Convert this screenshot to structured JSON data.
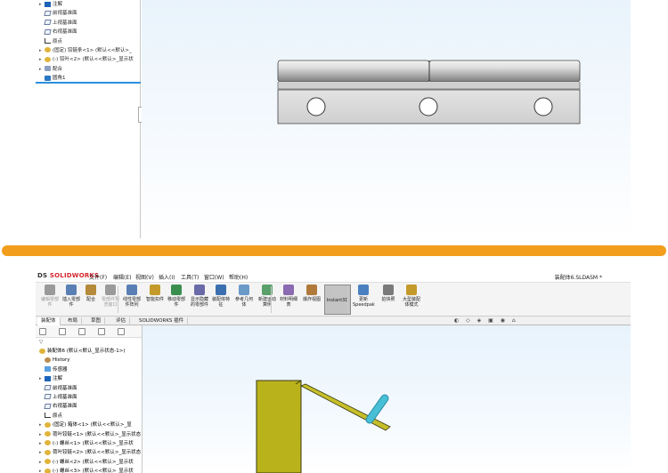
{
  "top_tree": {
    "items": [
      {
        "label": "注解",
        "icon": "annotation-icon",
        "expand": "▸"
      },
      {
        "label": "前视基准面",
        "icon": "plane-icon",
        "expand": ""
      },
      {
        "label": "上视基准面",
        "icon": "plane-icon",
        "expand": ""
      },
      {
        "label": "右视基准面",
        "icon": "plane-icon",
        "expand": ""
      },
      {
        "label": "原点",
        "icon": "origin-icon",
        "expand": ""
      },
      {
        "label": "(固定) 铰链条<1> (默认<<默认>_",
        "icon": "part-icon",
        "expand": "▸"
      },
      {
        "label": "(-) 铰叶<2> (默认<<默认>_显示状",
        "icon": "part-icon",
        "expand": "▸"
      },
      {
        "label": "配合",
        "icon": "mate-icon",
        "expand": "▸"
      },
      {
        "label": "圆角1",
        "icon": "fillet-icon",
        "expand": ""
      }
    ]
  },
  "app": {
    "logo_prefix": "DS",
    "logo_text": "SOLIDWORKS",
    "menus": [
      "文件(F)",
      "编辑(E)",
      "视图(V)",
      "插入(I)",
      "工具(T)",
      "窗口(W)",
      "帮助(H)"
    ],
    "document_title": "装配体6.SLDASM *"
  },
  "ribbon": {
    "buttons": [
      {
        "label": "编辑零部件",
        "disabled": true
      },
      {
        "label": "插入零部件",
        "disabled": false
      },
      {
        "label": "配合",
        "disabled": false
      },
      {
        "label": "零部件预览窗口",
        "disabled": true
      },
      {
        "label": "线性零部件阵列",
        "disabled": false
      },
      {
        "label": "智能扣件",
        "disabled": false
      },
      {
        "label": "移动零部件",
        "disabled": false
      },
      {
        "label": "显示隐藏的零部件",
        "disabled": false
      },
      {
        "label": "装配体特征",
        "disabled": false
      },
      {
        "label": "参考几何体",
        "disabled": false
      },
      {
        "label": "新建运动算例",
        "disabled": false
      },
      {
        "label": "材料明细表",
        "disabled": false
      },
      {
        "label": "爆炸视图",
        "disabled": false
      },
      {
        "label": "Instant3D",
        "disabled": false
      },
      {
        "label": "更新 Speedpak",
        "disabled": false
      },
      {
        "label": "拍快照",
        "disabled": false
      },
      {
        "label": "大型装配体模式",
        "disabled": false
      }
    ]
  },
  "tabs": [
    "装配体",
    "布局",
    "草图",
    "评估",
    "SOLIDWORKS 插件"
  ],
  "bottom_tree": {
    "root": "装配体6 (默认<默认_显示状态-1>)",
    "items": [
      {
        "label": "History",
        "icon": "history-icon",
        "expand": ""
      },
      {
        "label": "传感器",
        "icon": "sensor-icon",
        "expand": ""
      },
      {
        "label": "注解",
        "icon": "annotation-icon",
        "expand": "▸"
      },
      {
        "label": "前视基准面",
        "icon": "plane-icon",
        "expand": ""
      },
      {
        "label": "上视基准面",
        "icon": "plane-icon",
        "expand": ""
      },
      {
        "label": "右视基准面",
        "icon": "plane-icon",
        "expand": ""
      },
      {
        "label": "原点",
        "icon": "origin-icon",
        "expand": ""
      },
      {
        "label": "(固定) 箱体<1> (默认<<默认>_显",
        "icon": "part-icon",
        "expand": "▸"
      },
      {
        "label": "荷叶铰链<1> (默认<<默认>_显示状态",
        "icon": "part-icon",
        "expand": "▸"
      },
      {
        "label": "(-) 螺丝<1> (默认<<默认>_显示状",
        "icon": "part-icon",
        "expand": "▸"
      },
      {
        "label": "荷叶铰链<2> (默认<<默认>_显示状态",
        "icon": "part-icon",
        "expand": "▸"
      },
      {
        "label": "(-) 螺丝<2> (默认<<默认>_显示状",
        "icon": "part-icon",
        "expand": "▸"
      },
      {
        "label": "(-) 螺丝<3> (默认<<默认>_显示状",
        "icon": "part-icon",
        "expand": "▸"
      }
    ]
  },
  "colors": {
    "divider": "#f29d1b",
    "part_yellow": "#b9b21b",
    "handle_cyan": "#47bfd6",
    "selection_blue": "#2b8ee0"
  }
}
